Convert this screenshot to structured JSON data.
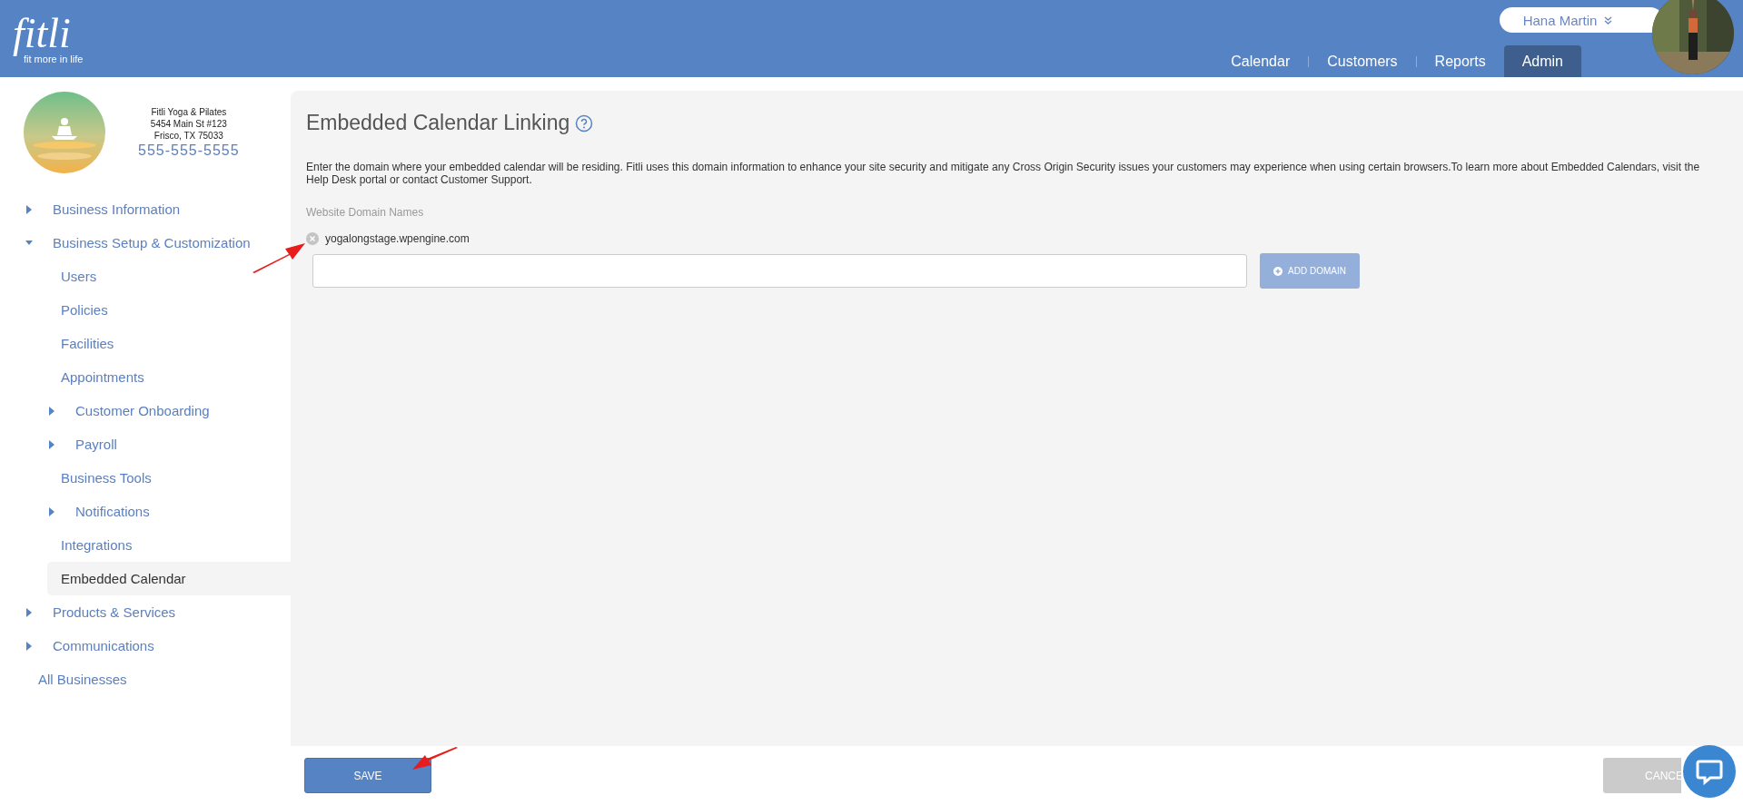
{
  "header": {
    "logo": {
      "name": "fitli",
      "tagline": "fit more in life"
    },
    "user": {
      "name": "Hana Martin"
    },
    "nav": [
      {
        "label": "Calendar",
        "selected": false
      },
      {
        "label": "Customers",
        "selected": false
      },
      {
        "label": "Reports",
        "selected": false
      },
      {
        "label": "Admin",
        "selected": true
      }
    ]
  },
  "business": {
    "name": "Fitli Yoga & Pilates",
    "street": "5454 Main St #123",
    "city": "Frisco, TX 75033",
    "phone": "555-555-5555"
  },
  "sidebar": {
    "items": [
      {
        "label": "Business Information",
        "expanded": false,
        "selected": false
      },
      {
        "label": "Business Setup & Customization",
        "expanded": true,
        "selected": false,
        "children": [
          {
            "label": "Users",
            "selected": false
          },
          {
            "label": "Policies",
            "selected": false
          },
          {
            "label": "Facilities",
            "selected": false
          },
          {
            "label": "Appointments",
            "selected": false
          },
          {
            "label": "Customer Onboarding",
            "expanded": false,
            "selected": false
          },
          {
            "label": "Payroll",
            "expanded": false,
            "selected": false
          },
          {
            "label": "Business Tools",
            "selected": false
          },
          {
            "label": "Notifications",
            "expanded": false,
            "selected": false
          },
          {
            "label": "Integrations",
            "selected": false
          },
          {
            "label": "Embedded Calendar",
            "selected": true
          }
        ]
      },
      {
        "label": "Products & Services",
        "expanded": false,
        "selected": false
      },
      {
        "label": "Communications",
        "expanded": false,
        "selected": false
      },
      {
        "label": "All Businesses",
        "selected": false
      }
    ]
  },
  "main": {
    "title": "Embedded Calendar Linking",
    "description": "Enter the domain where your embedded calendar will be residing. Fitli uses this domain information to enhance your site security and mitigate any Cross Origin Security issues your customers may experience when using certain browsers.To learn more about Embedded Calendars, visit the Help Desk portal or contact Customer Support.",
    "domains_label": "Website Domain Names",
    "domains": [
      "yogalongstage.wpengine.com"
    ],
    "add_button": "ADD DOMAIN"
  },
  "footer": {
    "save": "SAVE",
    "cancel": "CANCE"
  }
}
